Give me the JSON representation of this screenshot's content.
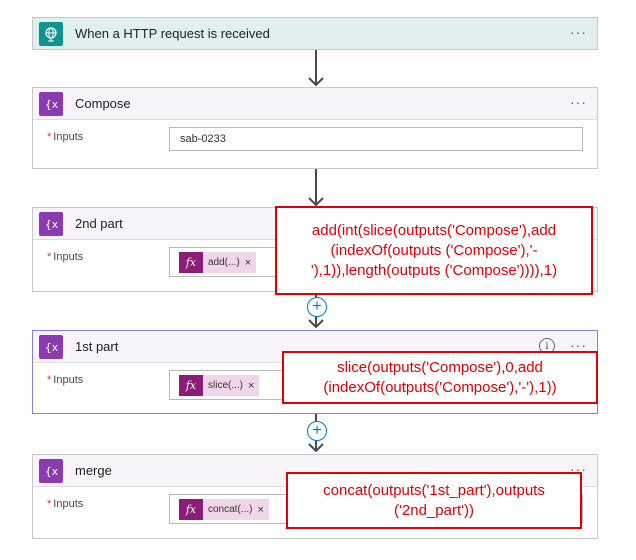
{
  "trigger": {
    "title": "When a HTTP request is received",
    "more": "···",
    "icon": "globe-icon",
    "color": "#0d9591"
  },
  "steps": [
    {
      "title": "Compose",
      "label": "Inputs",
      "required": "*",
      "value": "sab-0233",
      "more": "···",
      "icon": "compose-icon"
    },
    {
      "title": "2nd part",
      "label": "Inputs",
      "required": "*",
      "token": "add(...)",
      "more": "···",
      "icon": "compose-icon"
    },
    {
      "title": "1st part",
      "label": "Inputs",
      "required": "*",
      "token": "slice(...)",
      "more": "···",
      "info": "i",
      "icon": "compose-icon"
    },
    {
      "title": "merge",
      "label": "Inputs",
      "required": "*",
      "token": "concat(...)",
      "more": "···",
      "icon": "compose-icon"
    }
  ],
  "token_icon_label": "fx",
  "token_remove": "×",
  "callouts": {
    "second_part": "add(int(slice(outputs('Compose'),add (indexOf(outputs ('Compose'),'-'),1)),length(outputs ('Compose')))),1)",
    "first_part": "slice(outputs('Compose'),0,add (indexOf(outputs('Compose'),'-'),1))",
    "merge": "concat(outputs('1st_part'),outputs ('2nd_part'))"
  },
  "colors": {
    "compose": "#8b3bb2",
    "token": "#8b1c78",
    "callout": "#e00000",
    "add": "#0078d4"
  }
}
